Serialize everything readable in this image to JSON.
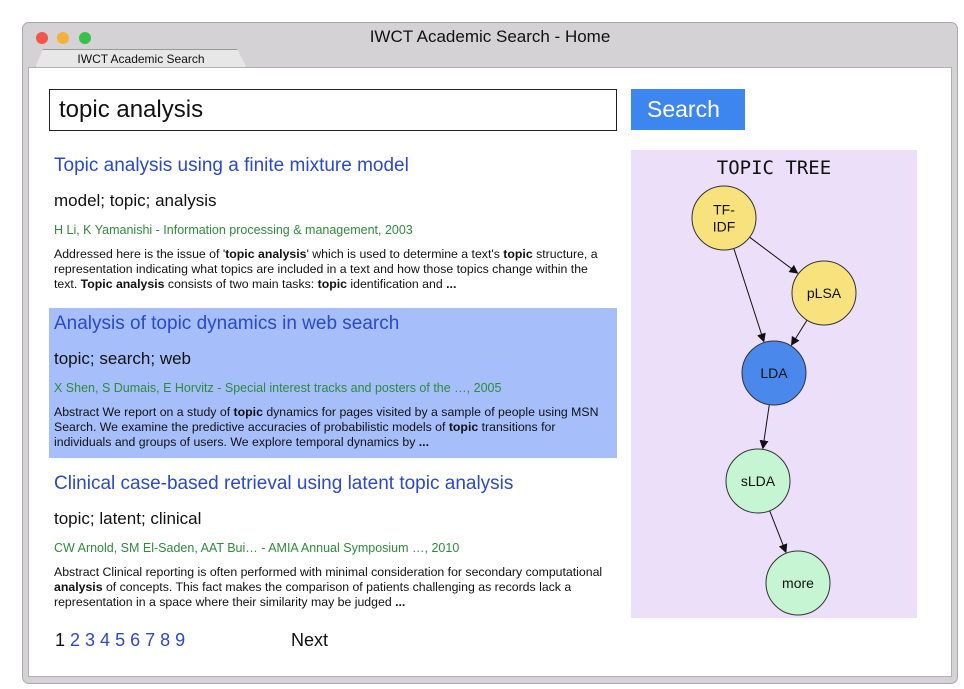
{
  "window": {
    "title": "IWCT Academic Search - Home",
    "tab_label": "IWCT Academic Search"
  },
  "search": {
    "value": "topic analysis",
    "button_label": "Search"
  },
  "results": [
    {
      "title": "Topic analysis using a finite mixture model",
      "tags": "model; topic; analysis",
      "authors": "H Li, K Yamanishi - Information processing & management, 2003",
      "snippet": [
        {
          "t": "Addressed here is the issue of '"
        },
        {
          "t": "topic analysis",
          "b": true
        },
        {
          "t": "' which is used to determine a text's "
        },
        {
          "t": "topic",
          "b": true
        },
        {
          "t": " structure, a representation indicating what topics are included in a text and how those topics change within the text. "
        },
        {
          "t": "Topic analysis",
          "b": true
        },
        {
          "t": " consists of two main tasks: "
        },
        {
          "t": "topic",
          "b": true
        },
        {
          "t": " identification and "
        },
        {
          "t": "...",
          "b": true
        }
      ]
    },
    {
      "title": "Analysis of topic dynamics in web search",
      "tags": "topic; search; web",
      "authors": "X Shen, S Dumais, E Horvitz - Special interest tracks and posters of the …, 2005",
      "snippet": [
        {
          "t": "Abstract We report on a study of "
        },
        {
          "t": "topic",
          "b": true
        },
        {
          "t": " dynamics for pages visited by a sample of people using MSN Search. We examine the predictive accuracies of probabilistic models of "
        },
        {
          "t": "topic",
          "b": true
        },
        {
          "t": " transitions for individuals and groups of users. We explore temporal dynamics by "
        },
        {
          "t": "...",
          "b": true
        }
      ]
    },
    {
      "title": "Clinical case-based retrieval using latent topic analysis",
      "tags": "topic; latent; clinical",
      "authors": "CW Arnold, SM El-Saden, AAT Bui… - AMIA Annual Symposium …, 2010",
      "snippet": [
        {
          "t": "Abstract Clinical reporting is often performed with minimal consideration for secondary computational "
        },
        {
          "t": "analysis",
          "b": true
        },
        {
          "t": " of concepts. This fact makes the comparison of patients challenging as records lack a representation in a space where their similarity may be judged "
        },
        {
          "t": "...",
          "b": true
        }
      ]
    }
  ],
  "pagination": {
    "pages": [
      "1",
      "2",
      "3",
      "4",
      "5",
      "6",
      "7",
      "8",
      "9"
    ],
    "current": "1",
    "next_label": "Next"
  },
  "topic_tree": {
    "title": "TOPIC TREE",
    "nodes": [
      {
        "id": "tfidf",
        "label": [
          "TF-",
          "IDF"
        ],
        "color": "#f7e27e"
      },
      {
        "id": "plsa",
        "label": [
          "pLSA"
        ],
        "color": "#f7e27e"
      },
      {
        "id": "lda",
        "label": [
          "LDA"
        ],
        "color": "#4a88ec"
      },
      {
        "id": "slda",
        "label": [
          "sLDA"
        ],
        "color": "#c5f5d2"
      },
      {
        "id": "more",
        "label": [
          "more"
        ],
        "color": "#c5f5d2"
      }
    ],
    "edges": [
      [
        "tfidf",
        "plsa"
      ],
      [
        "tfidf",
        "lda"
      ],
      [
        "plsa",
        "lda"
      ],
      [
        "lda",
        "slda"
      ],
      [
        "slda",
        "more"
      ]
    ]
  },
  "colors": {
    "accent": "#3d86f0",
    "link": "#2b49c8",
    "author": "#2f8a3c",
    "highlight": "#a6bffb",
    "panel": "#ecdff9"
  }
}
